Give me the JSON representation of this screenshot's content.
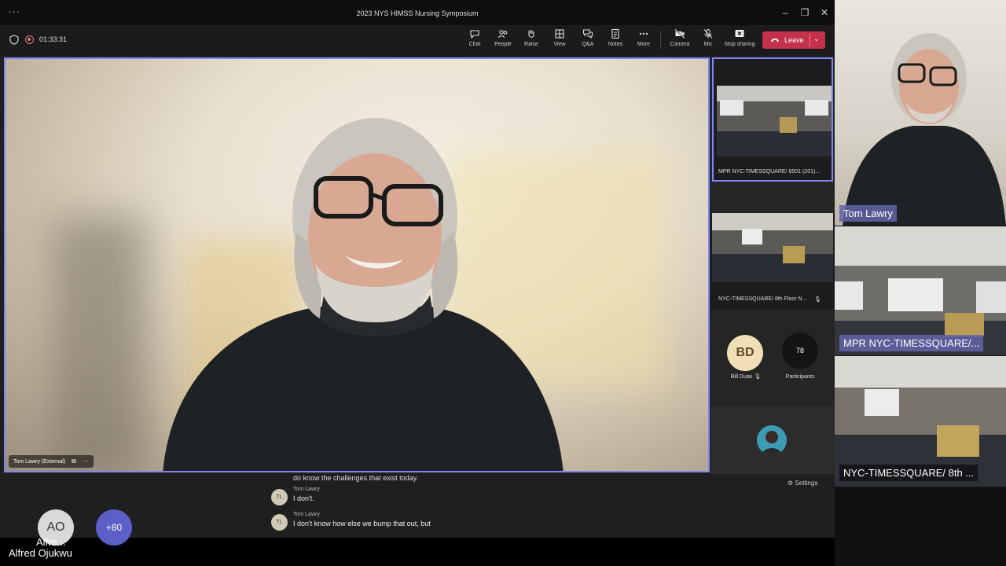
{
  "window": {
    "title": "2023 NYS HIMSS Nursing Symposium",
    "timer": "01:33:31"
  },
  "toolbar": {
    "chat": "Chat",
    "people": "People",
    "raise": "Raise",
    "view": "View",
    "qa": "Q&A",
    "notes": "Notes",
    "more": "More",
    "camera": "Camera",
    "mic": "Mic",
    "stop_sharing": "Stop sharing",
    "leave": "Leave"
  },
  "main_video": {
    "name": "Tom Lawry (External)"
  },
  "right_panel": {
    "tile1_label": "MPR NYC-TIMESSQUARE/ 6501 (201)...",
    "tile2_label": "NYC-TIMESSQUARE/ 8th Floor N...",
    "bd_initials": "BD",
    "bd_name": "Bill Duax",
    "participants_count": "78",
    "participants_label": "Participants"
  },
  "captions": {
    "top_line": "do know the challenges that exist today.",
    "rows": [
      {
        "initials": "TL",
        "name": "Tom Lawry",
        "text": "I don't."
      },
      {
        "initials": "TL",
        "name": "Tom Lawry",
        "text": "I don't know how else we bump that out, but"
      }
    ],
    "settings": "Settings"
  },
  "bottom_bar": {
    "current_user": "Alfred Ojukwu"
  },
  "outer_gallery": {
    "tile1_label": "Tom Lawry",
    "tile2_label": "MPR NYC-TIMESSQUARE/...",
    "tile3_label": "NYC-TIMESSQUARE/ 8th ...",
    "ao_initials": "AO",
    "ao_name": "Alfre...",
    "more_count": "+80"
  },
  "colors": {
    "accent": "#7f85f5",
    "leave": "#c4314b",
    "recording": "#e37d80"
  }
}
